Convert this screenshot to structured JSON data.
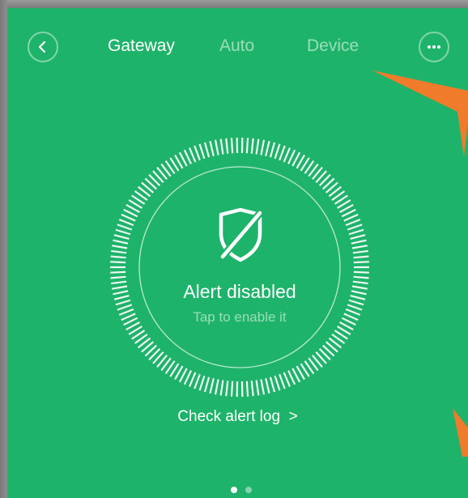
{
  "header": {
    "tabs": [
      {
        "label": "Gateway",
        "active": true
      },
      {
        "label": "Auto",
        "active": false
      },
      {
        "label": "Device",
        "active": false
      }
    ],
    "back_icon": "chevron-left-icon",
    "more_icon": "more-horizontal-icon"
  },
  "alert": {
    "title": "Alert disabled",
    "subtitle": "Tap to enable it",
    "icon": "shield-off-icon"
  },
  "check_log_label": "Check alert log  >",
  "pager": {
    "count": 2,
    "active_index": 0
  },
  "colors": {
    "background": "#1eb36a",
    "arrow": "#f07b2b",
    "text": "#ffffff"
  }
}
